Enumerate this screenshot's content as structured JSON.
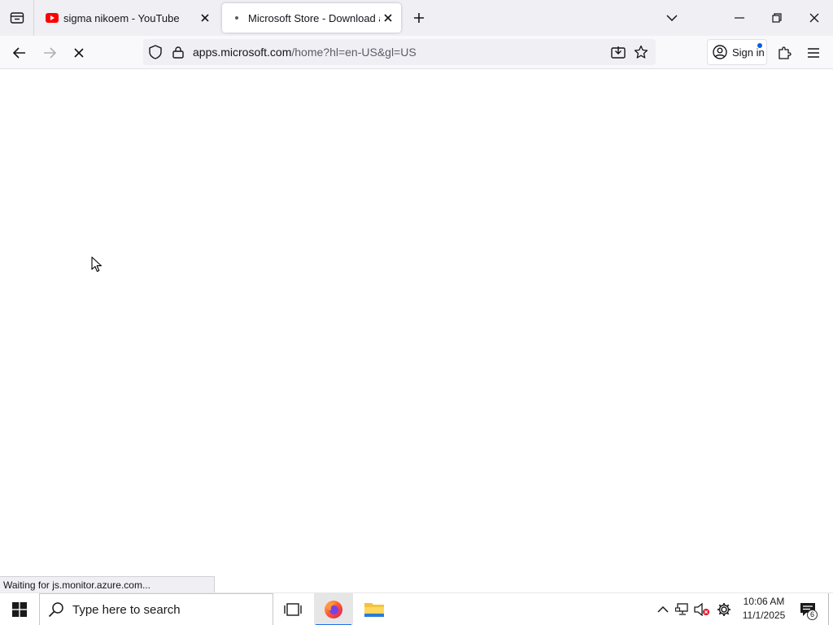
{
  "browser": {
    "tabs": [
      {
        "title": "sigma nikoem - YouTube",
        "favicon": "youtube-icon",
        "active": false
      },
      {
        "title": "Microsoft Store - Download apps",
        "favicon": "loading-dot",
        "active": true
      }
    ],
    "url": {
      "host": "apps.microsoft.com",
      "path": "/home?hl=en-US&gl=US"
    },
    "sign_in_label": "Sign in",
    "status_text": "Waiting for js.monitor.azure.com...",
    "accent_color": "#0060df"
  },
  "taskbar": {
    "search_placeholder": "Type here to search",
    "time": "10:06 AM",
    "date": "11/1/2025",
    "notification_count": "6"
  }
}
